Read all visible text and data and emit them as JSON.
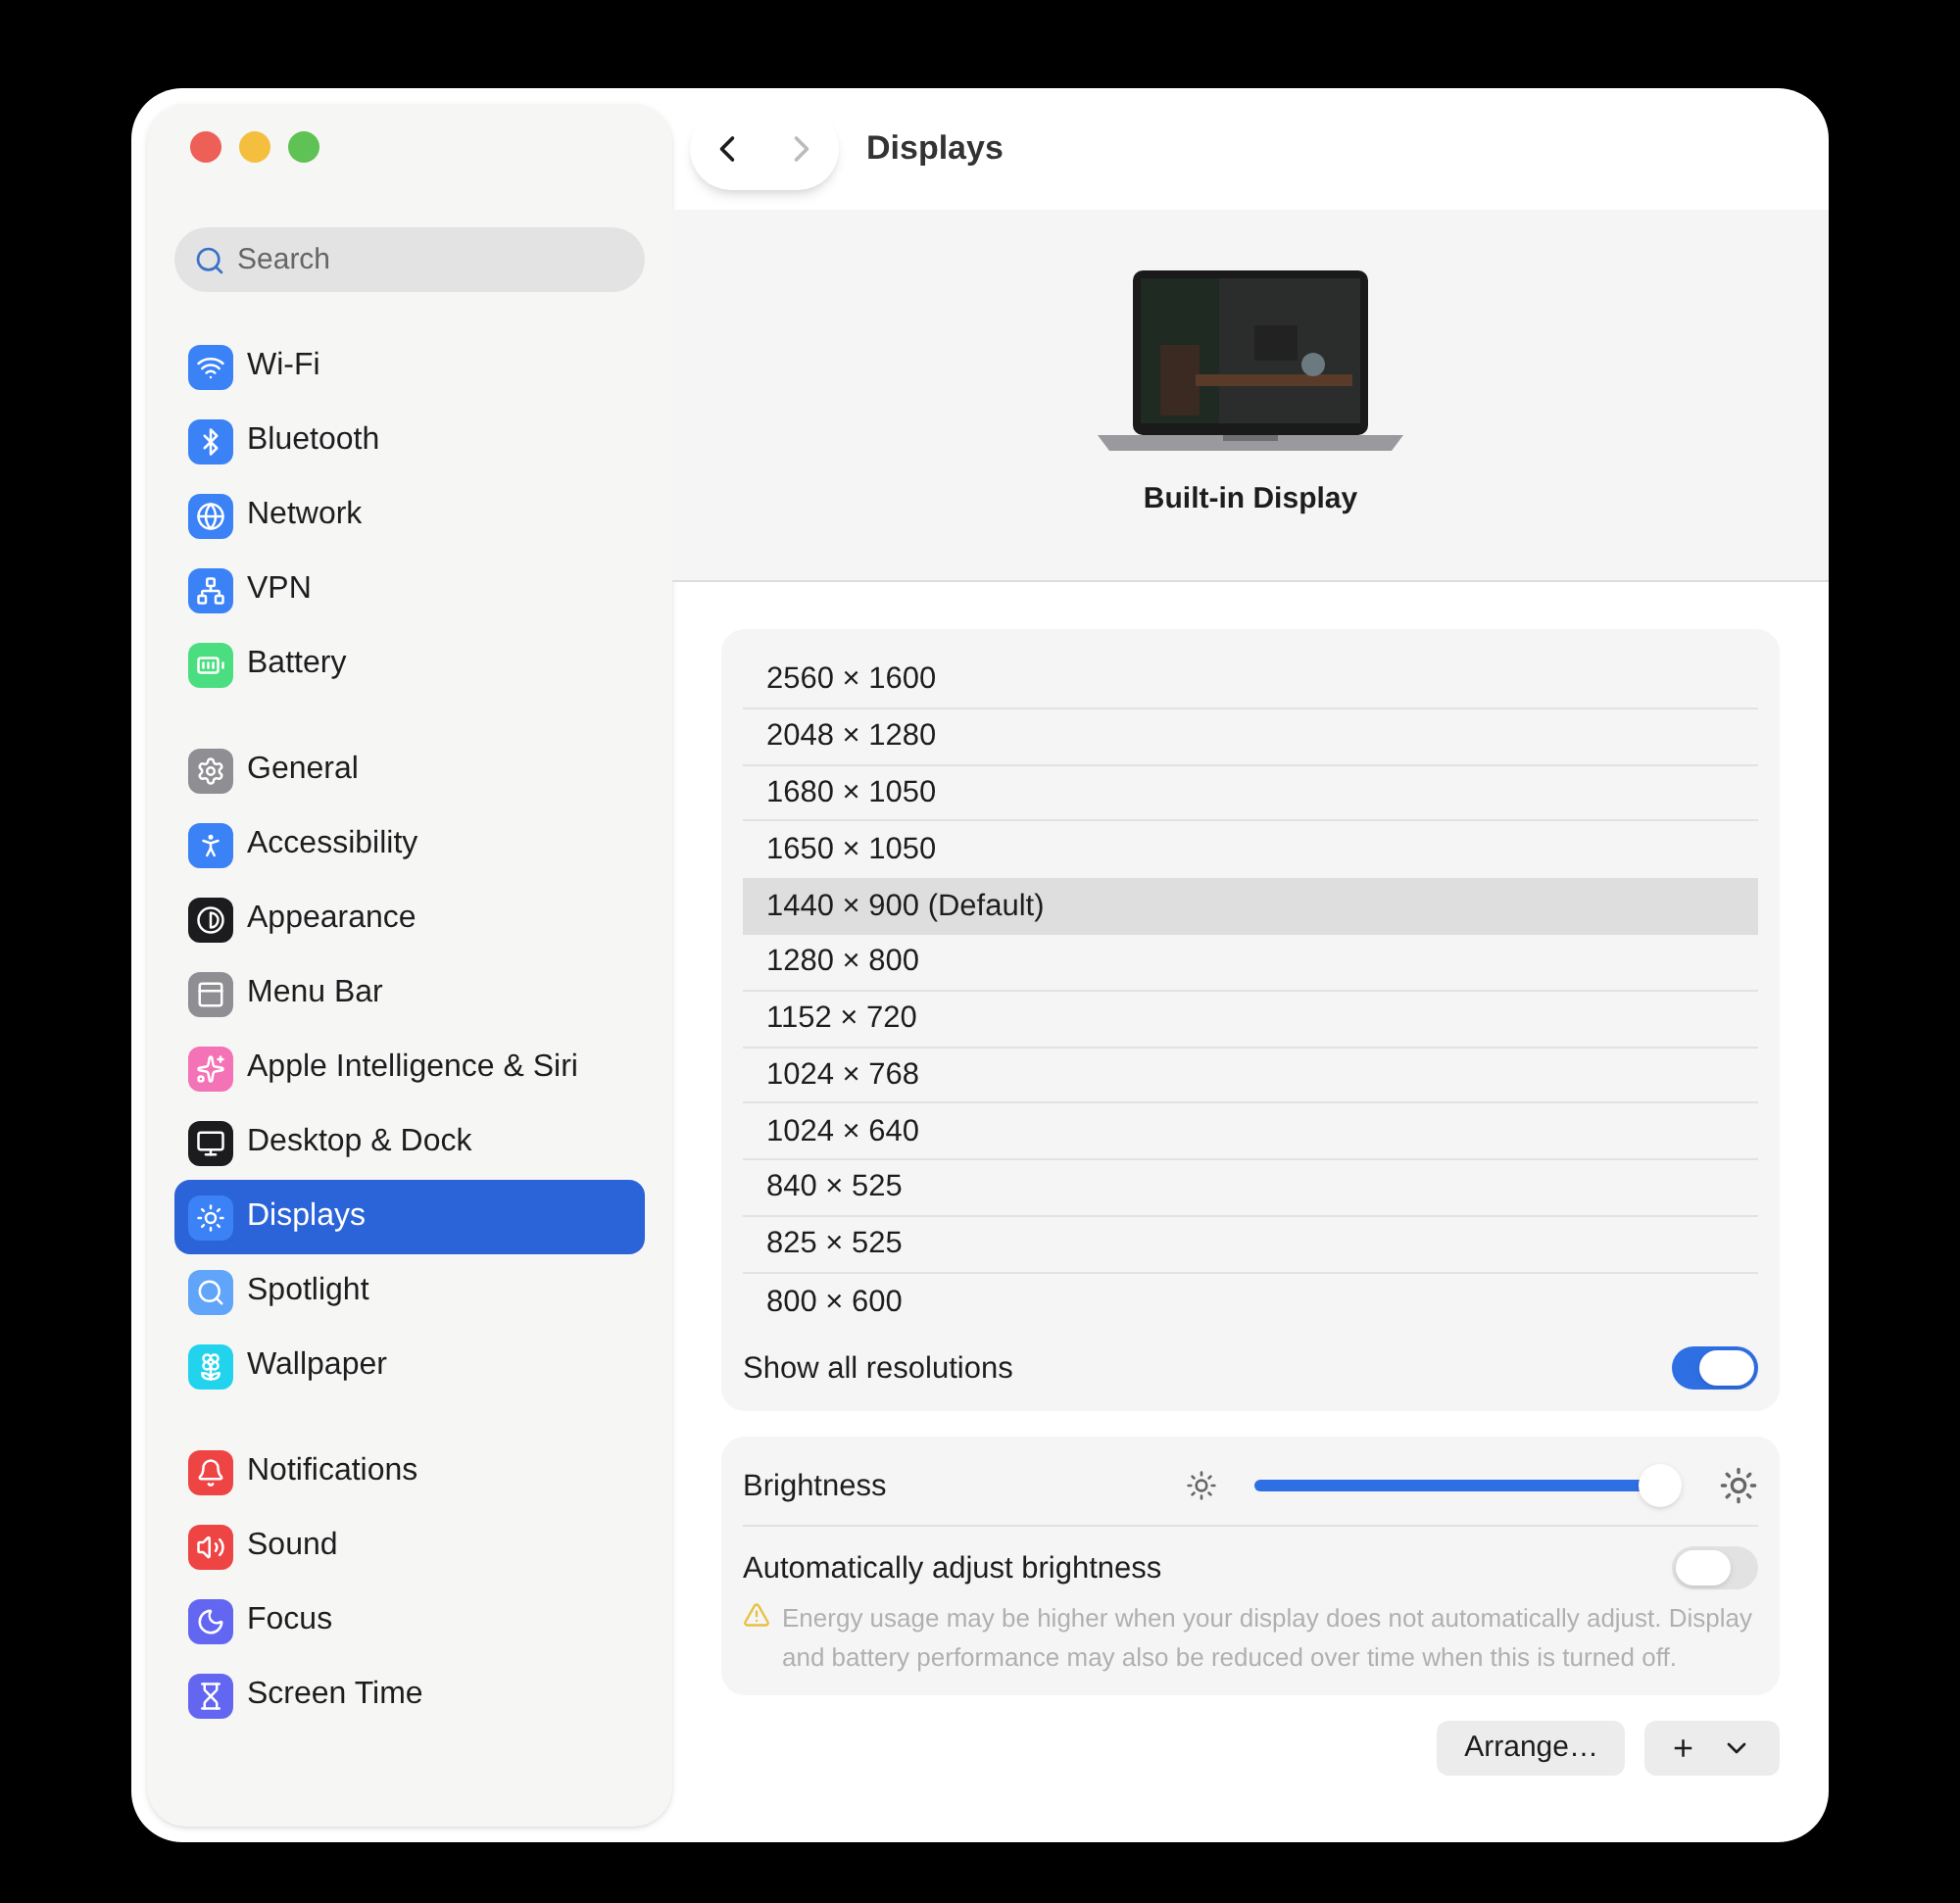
{
  "window": {
    "title": "Displays"
  },
  "search": {
    "placeholder": "Search"
  },
  "sidebar": {
    "groups": [
      [
        {
          "label": "Wi-Fi",
          "kind": "wifi",
          "color": "#3b82f6",
          "selected": false
        },
        {
          "label": "Bluetooth",
          "kind": "bluetooth",
          "color": "#3b82f6",
          "selected": false
        },
        {
          "label": "Network",
          "kind": "network",
          "color": "#3b82f6",
          "selected": false
        },
        {
          "label": "VPN",
          "kind": "vpn",
          "color": "#3b82f6",
          "selected": false
        },
        {
          "label": "Battery",
          "kind": "battery",
          "color": "#4ade80",
          "selected": false
        }
      ],
      [
        {
          "label": "General",
          "kind": "general",
          "color": "#8e8e93",
          "selected": false
        },
        {
          "label": "Accessibility",
          "kind": "accessibility",
          "color": "#3b82f6",
          "selected": false
        },
        {
          "label": "Appearance",
          "kind": "appearance",
          "color": "#1c1c1e",
          "selected": false
        },
        {
          "label": "Menu Bar",
          "kind": "menubar",
          "color": "#8e8e93",
          "selected": false
        },
        {
          "label": "Apple Intelligence & Siri",
          "kind": "siri",
          "color": "#f472b6",
          "selected": false
        },
        {
          "label": "Desktop & Dock",
          "kind": "dock",
          "color": "#1c1c1e",
          "selected": false
        },
        {
          "label": "Displays",
          "kind": "displays",
          "color": "#3b82f6",
          "selected": true
        },
        {
          "label": "Spotlight",
          "kind": "spotlight",
          "color": "#60a5fa",
          "selected": false
        },
        {
          "label": "Wallpaper",
          "kind": "wallpaper",
          "color": "#22d3ee",
          "selected": false
        }
      ],
      [
        {
          "label": "Notifications",
          "kind": "notifications",
          "color": "#ef4444",
          "selected": false
        },
        {
          "label": "Sound",
          "kind": "sound",
          "color": "#ef4444",
          "selected": false
        },
        {
          "label": "Focus",
          "kind": "focus",
          "color": "#6366f1",
          "selected": false
        },
        {
          "label": "Screen Time",
          "kind": "screentime",
          "color": "#6366f1",
          "selected": false
        }
      ]
    ]
  },
  "display": {
    "name": "Built-in Display"
  },
  "resolutions": [
    {
      "label": "2560 × 1600",
      "selected": false
    },
    {
      "label": "2048 × 1280",
      "selected": false
    },
    {
      "label": "1680 × 1050",
      "selected": false
    },
    {
      "label": "1650 × 1050",
      "selected": false
    },
    {
      "label": "1440 × 900 (Default)",
      "selected": true
    },
    {
      "label": "1280 × 800",
      "selected": false
    },
    {
      "label": "1152 × 720",
      "selected": false
    },
    {
      "label": "1024 × 768",
      "selected": false
    },
    {
      "label": "1024 × 640",
      "selected": false
    },
    {
      "label": "840 × 525",
      "selected": false
    },
    {
      "label": "825 × 525",
      "selected": false
    },
    {
      "label": "800 × 600",
      "selected": false
    }
  ],
  "show_all": {
    "label": "Show all resolutions",
    "on": true
  },
  "brightness": {
    "label": "Brightness",
    "level": 0.95
  },
  "auto_brightness": {
    "label": "Automatically adjust brightness",
    "on": false,
    "warning": "Energy usage may be higher when your display does not automatically adjust. Display and battery performance may also be reduced over time when this is turned off."
  },
  "footer": {
    "arrange": "Arrange…",
    "add": "+"
  }
}
